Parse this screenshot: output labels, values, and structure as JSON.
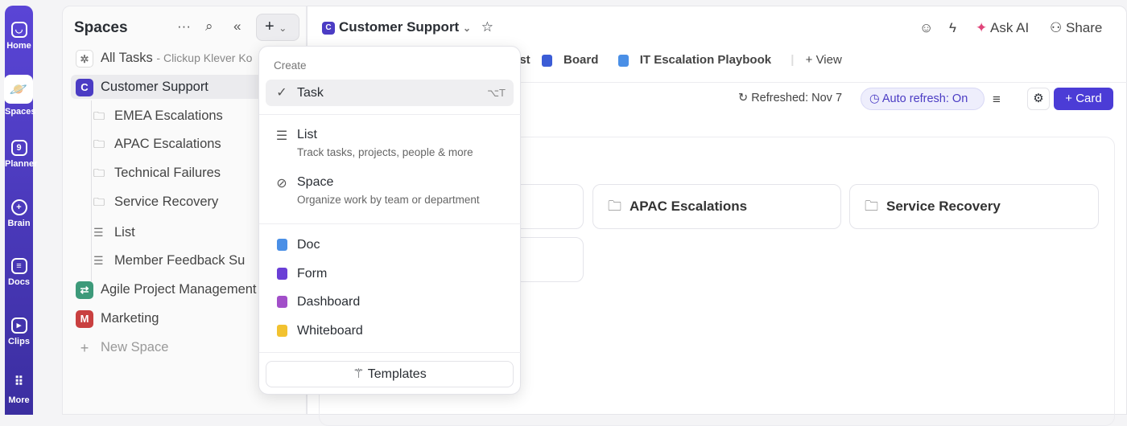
{
  "rail": [
    {
      "label": "Home"
    },
    {
      "label": "Spaces"
    },
    {
      "label": "Planner"
    },
    {
      "label": "Brain"
    },
    {
      "label": "Docs"
    },
    {
      "label": "Clips"
    },
    {
      "label": "More"
    }
  ],
  "sidebar": {
    "title": "Spaces",
    "all_tasks": "All Tasks",
    "all_tasks_sub": "- Clickup Klever Ko",
    "spaces": [
      {
        "badge": "C",
        "label": "Customer Support",
        "color": "#4b3cc4"
      },
      {
        "badge": "⇄",
        "label": "Agile Project Management",
        "color": "#3d9a7a"
      },
      {
        "badge": "M",
        "label": "Marketing",
        "color": "#c94040"
      }
    ],
    "children": [
      {
        "type": "folder",
        "label": "EMEA Escalations"
      },
      {
        "type": "folder",
        "label": "APAC Escalations"
      },
      {
        "type": "folder",
        "label": "Technical Failures"
      },
      {
        "type": "folder",
        "label": "Service Recovery"
      },
      {
        "type": "list",
        "label": "List"
      },
      {
        "type": "list",
        "label": "Member Feedback Su"
      }
    ],
    "new_space": "New Space"
  },
  "header": {
    "badge": "C",
    "title": "Customer Support",
    "ai": "Ask AI",
    "share": "Share"
  },
  "tabs": {
    "list": "List",
    "board": "Board",
    "doc": "IT Escalation Playbook",
    "view": "View"
  },
  "toolbar": {
    "refreshed": "Refreshed: Nov 7",
    "auto_refresh": "Auto refresh: On",
    "card": "Card"
  },
  "cards": [
    "APAC Escalations",
    "Service Recovery"
  ],
  "dropdown": {
    "header": "Create",
    "task": "Task",
    "task_shortcut": "⌥T",
    "list": "List",
    "list_desc": "Track tasks, projects, people & more",
    "space": "Space",
    "space_desc": "Organize work by team or department",
    "doc": "Doc",
    "form": "Form",
    "dashboard": "Dashboard",
    "whiteboard": "Whiteboard",
    "templates": "Templates"
  }
}
